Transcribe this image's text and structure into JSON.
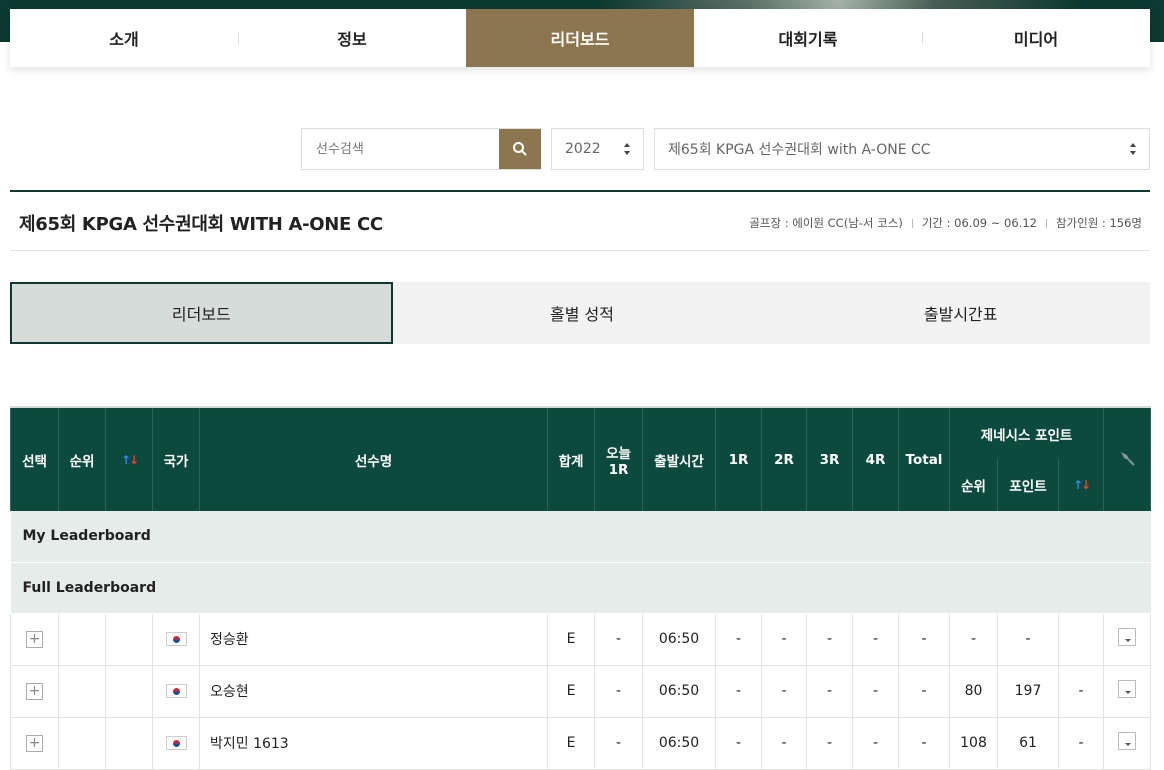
{
  "top_nav": [
    "소개",
    "정보",
    "리더보드",
    "대회기록",
    "미디어"
  ],
  "search": {
    "placeholder": "선수검색"
  },
  "year_select": {
    "value": "2022"
  },
  "tournament_select": {
    "value": "제65회 KPGA 선수권대회 with A-ONE CC"
  },
  "tournament": {
    "title": "제65회 KPGA 선수권대회 WITH A-ONE CC",
    "course": "골프장 : 에이원 CC(남-서 코스)",
    "period": "기간 : 06.09 ~ 06.12",
    "players": "참가인원 : 156명"
  },
  "sub_tabs": [
    "리더보드",
    "홀별 성적",
    "출발시간표"
  ],
  "table": {
    "headers": {
      "select": "선택",
      "rank": "순위",
      "country": "국가",
      "player": "선수명",
      "total": "합계",
      "today_line1": "오늘",
      "today_line2": "1R",
      "tee_time": "출발시간",
      "r1": "1R",
      "r2": "2R",
      "r3": "3R",
      "r4": "4R",
      "total_score": "Total",
      "genesis": "제네시스 포인트",
      "g_rank": "순위",
      "g_point": "포인트"
    },
    "groups": {
      "my": "My Leaderboard",
      "full": "Full Leaderboard"
    },
    "rows": [
      {
        "name": "정승환",
        "total": "E",
        "today": "-",
        "tee": "06:50",
        "r1": "-",
        "r2": "-",
        "r3": "-",
        "r4": "-",
        "tot": "-",
        "g_rank": "-",
        "g_point": "-",
        "g_move": ""
      },
      {
        "name": "오승현",
        "total": "E",
        "today": "-",
        "tee": "06:50",
        "r1": "-",
        "r2": "-",
        "r3": "-",
        "r4": "-",
        "tot": "-",
        "g_rank": "80",
        "g_point": "197",
        "g_move": "-"
      },
      {
        "name": "박지민 1613",
        "total": "E",
        "today": "-",
        "tee": "06:50",
        "r1": "-",
        "r2": "-",
        "r3": "-",
        "r4": "-",
        "tot": "-",
        "g_rank": "108",
        "g_point": "61",
        "g_move": "-"
      }
    ]
  },
  "colors": {
    "dark_green": "#0d4a3e",
    "gold": "#8b7650",
    "header_bg": "#0d3a30"
  }
}
